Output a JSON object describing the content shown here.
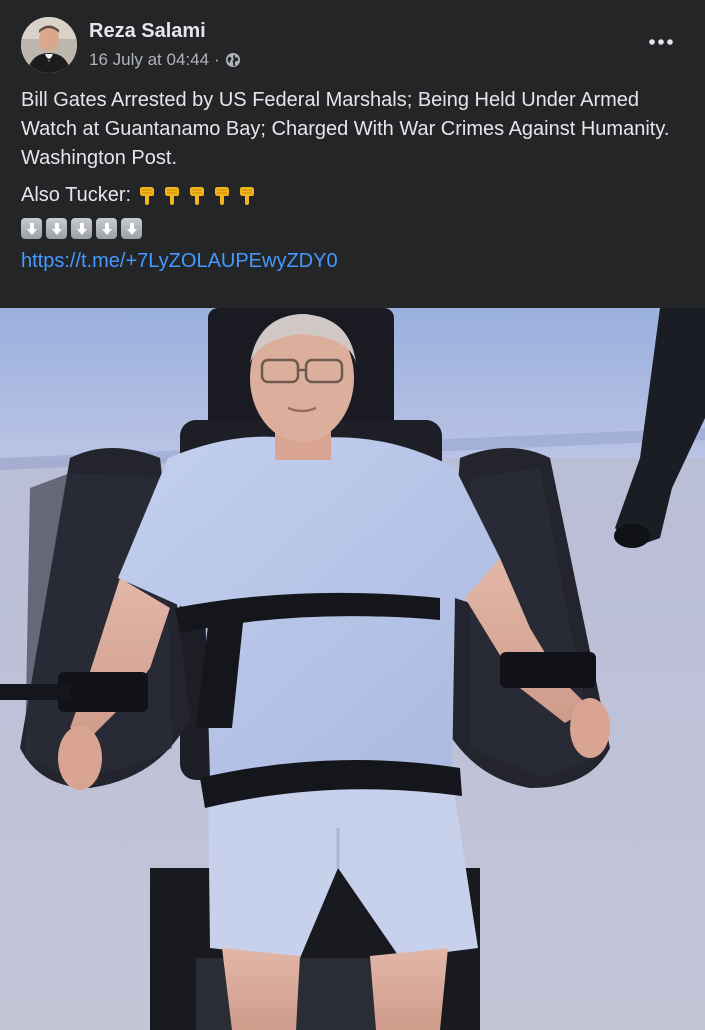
{
  "post": {
    "author": "Reza Salami",
    "timestamp": "16 July at 04:44",
    "audience_separator": "·",
    "audience_icon": "globe-icon",
    "more_icon": "more-options-icon",
    "body": {
      "paragraph_1": "Bill Gates Arrested by US Federal Marshals; Being Held Under Armed Watch at Guantanamo Bay; Charged With War Crimes Against Humanity. Washington Post.",
      "tucker_label": "Also Tucker:",
      "pointing_emoji_count": 5,
      "down_arrow_emoji_count": 5,
      "link": "https://t.me/+7LyZOLAUPEwyZDY0"
    },
    "image": {
      "description_icon": "photo-restraint-chair"
    }
  },
  "colors": {
    "background": "#242526",
    "text_primary": "#e4e6eb",
    "text_secondary": "#b0b3b8",
    "link": "#4599ff"
  }
}
